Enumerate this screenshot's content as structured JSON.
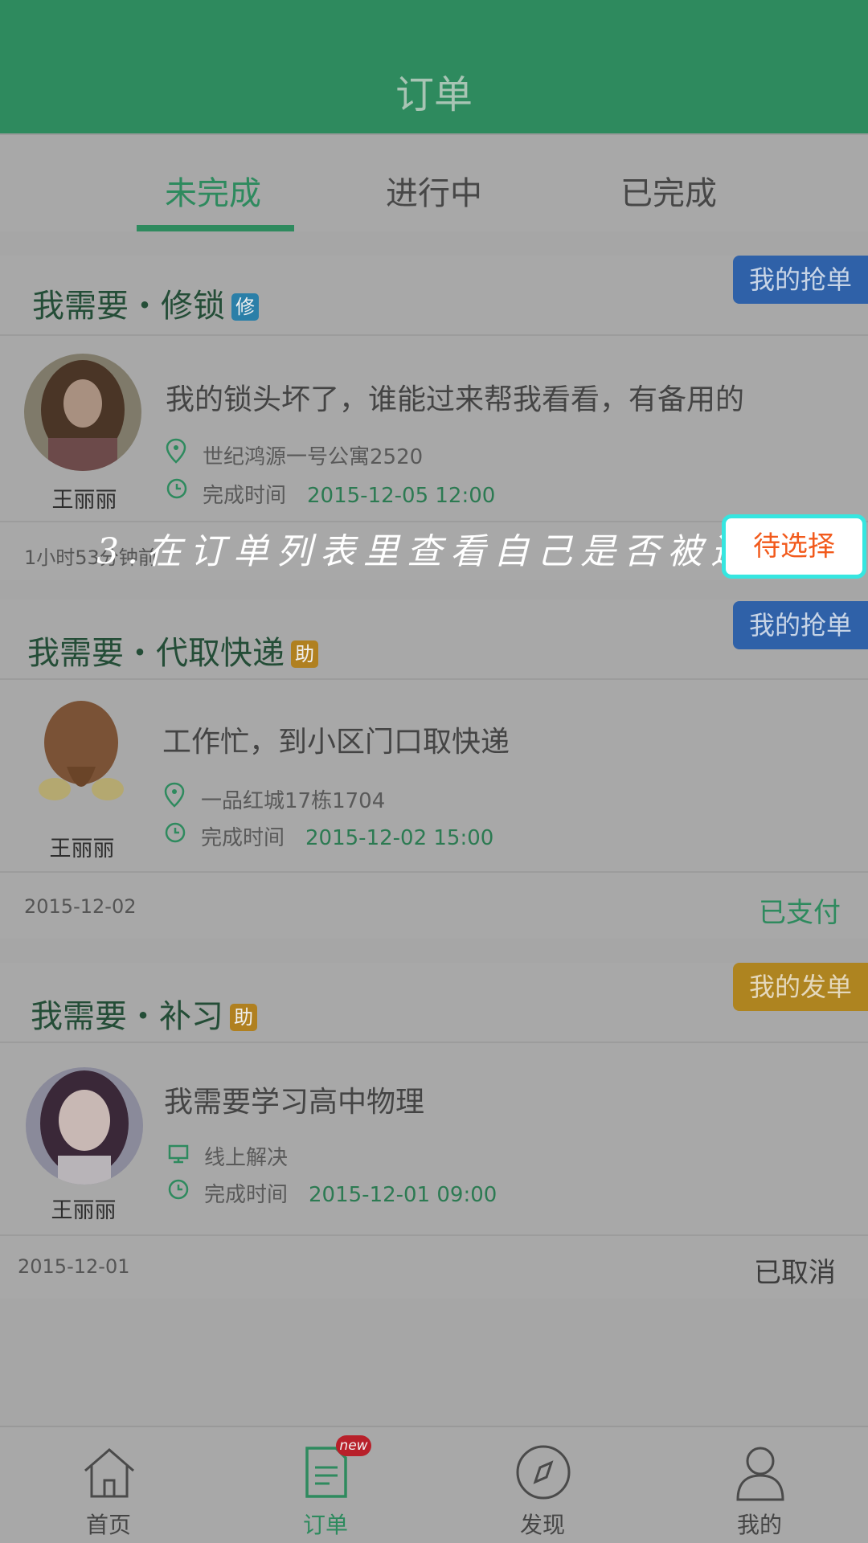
{
  "header": {
    "title": "订单"
  },
  "tabs": [
    {
      "label": "未完成",
      "active": true
    },
    {
      "label": "进行中",
      "active": false
    },
    {
      "label": "已完成",
      "active": false
    }
  ],
  "orders": [
    {
      "need": "我需要・修锁",
      "badge": "修",
      "tag": "我的抢单",
      "avatar_name": "王丽丽",
      "description": "我的锁头坏了，谁能过来帮我看看，有备用的",
      "location": "世纪鸿源一号公寓2520",
      "time_label": "完成时间",
      "time_value": "2015-12-05  12:00",
      "footer_left": "1小时53分钟前",
      "status": "待选择"
    },
    {
      "need": "我需要・代取快递",
      "badge": "助",
      "tag": "我的抢单",
      "avatar_name": "王丽丽",
      "description": "工作忙，到小区门口取快递",
      "location": "一品红城17栋1704",
      "time_label": "完成时间",
      "time_value": "2015-12-02  15:00",
      "footer_left": "2015-12-02",
      "status": "已支付"
    },
    {
      "need": "我需要・补习",
      "badge": "助",
      "tag": "我的发单",
      "avatar_name": "王丽丽",
      "description": "我需要学习高中物理",
      "location": "线上解决",
      "time_label": "完成时间",
      "time_value": "2015-12-01  09:00",
      "footer_left": "2015-12-01",
      "status": "已取消"
    }
  ],
  "guide_text": "3.在订单列表里查看自己是否被选中",
  "bottom_nav": [
    {
      "label": "首页",
      "icon": "home-icon"
    },
    {
      "label": "订单",
      "icon": "order-icon",
      "badge": "new"
    },
    {
      "label": "发现",
      "icon": "compass-icon"
    },
    {
      "label": "我的",
      "icon": "user-icon"
    }
  ],
  "colors": {
    "brand_green": "#2e8a5e",
    "tag_blue": "#2f61a8",
    "tag_yellow": "#ae8420",
    "pending_orange": "#f25a1c",
    "highlight_cyan": "#36e6e0"
  }
}
